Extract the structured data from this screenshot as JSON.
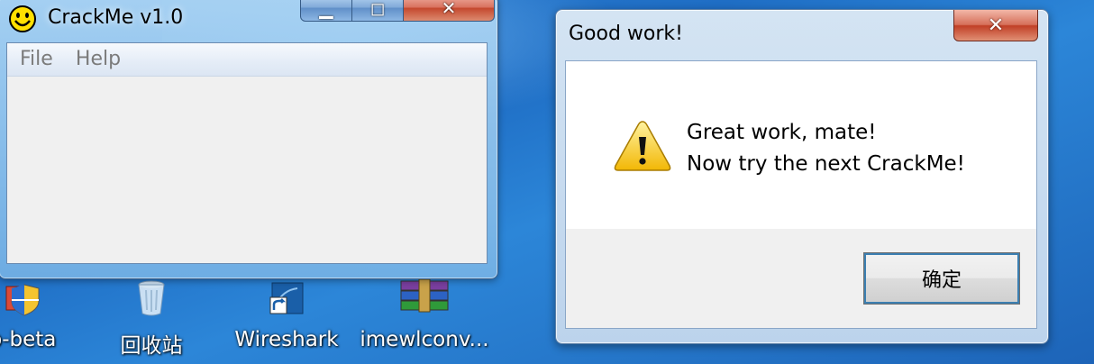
{
  "crackme_window": {
    "title": "CrackMe v1.0",
    "menu": [
      "File",
      "Help"
    ],
    "buttons": {
      "minimize": "▁",
      "maximize": "◻",
      "close": "✕"
    }
  },
  "dialog": {
    "title": "Good work!",
    "close_glyph": "✕",
    "message_line1": "Great work, mate!",
    "message_line2": "Now try the next CrackMe!",
    "ok_label": "确定",
    "icon": "warning-icon"
  },
  "desktop_icons": [
    {
      "label": "p-beta",
      "icon": "shield-app-icon"
    },
    {
      "label": "回收站",
      "icon": "recycle-bin-icon"
    },
    {
      "label": "Wireshark",
      "icon": "wireshark-shortcut-icon"
    },
    {
      "label": "imewlconv...",
      "icon": "winrar-archive-icon"
    }
  ],
  "colors": {
    "desktop": "#1f6ec5",
    "close_button": "#c4462c",
    "dialog_footer": "#f0f0f0"
  }
}
